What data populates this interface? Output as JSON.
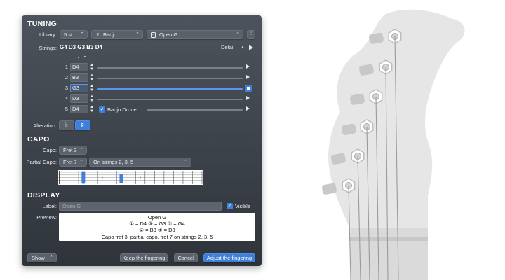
{
  "tuning": {
    "heading": "TUNING",
    "library_label": "Library:",
    "strings_count": "5 st.",
    "instrument": "Banjo",
    "tuning_name": "Open G",
    "more": "⋮",
    "strings_label": "Strings:",
    "strings_value": "G4 D3 G3 B3 D4",
    "detail_button": "Detail",
    "rows": [
      {
        "num": "1",
        "note": "D4"
      },
      {
        "num": "2",
        "note": "B3"
      },
      {
        "num": "3",
        "note": "G3"
      },
      {
        "num": "4",
        "note": "D3"
      },
      {
        "num": "5",
        "note": "D4"
      }
    ],
    "drone_label": "Banjo Drone",
    "alteration_label": "Alteration:",
    "flat_symbol": "♭",
    "sharp_symbol": "♯"
  },
  "capo": {
    "heading": "CAPO",
    "capo_label": "Capo:",
    "capo_value": "Fret 3",
    "partial_label": "Partial Capo:",
    "partial_value": "Fret 7",
    "partial_strings": "On strings 2, 3, 5",
    "capo_fret": 3,
    "partial_fret": 7
  },
  "display": {
    "heading": "DISPLAY",
    "label_label": "Label:",
    "label_placeholder": "Open G",
    "visible_label": "Visible",
    "preview_label": "Preview:",
    "preview_lines": [
      "Open G",
      "① = D4   ③ = G3   ⑤ = G4",
      "② = B3   ④ = D3",
      "Capo fret 3, partial capo. fret 7 on strings 2, 3, 5"
    ]
  },
  "footer": {
    "show": "Show",
    "keep": "Keep the fingering",
    "cancel": "Cancel",
    "adjust": "Adjust the fingering"
  },
  "icons": {
    "banjo": "banjo-icon",
    "library": "library-icon",
    "play": "play-icon",
    "checkbox": "checkmark-icon"
  },
  "colors": {
    "accent": "#3d7fd9",
    "headstock": "#e6e6e6"
  }
}
